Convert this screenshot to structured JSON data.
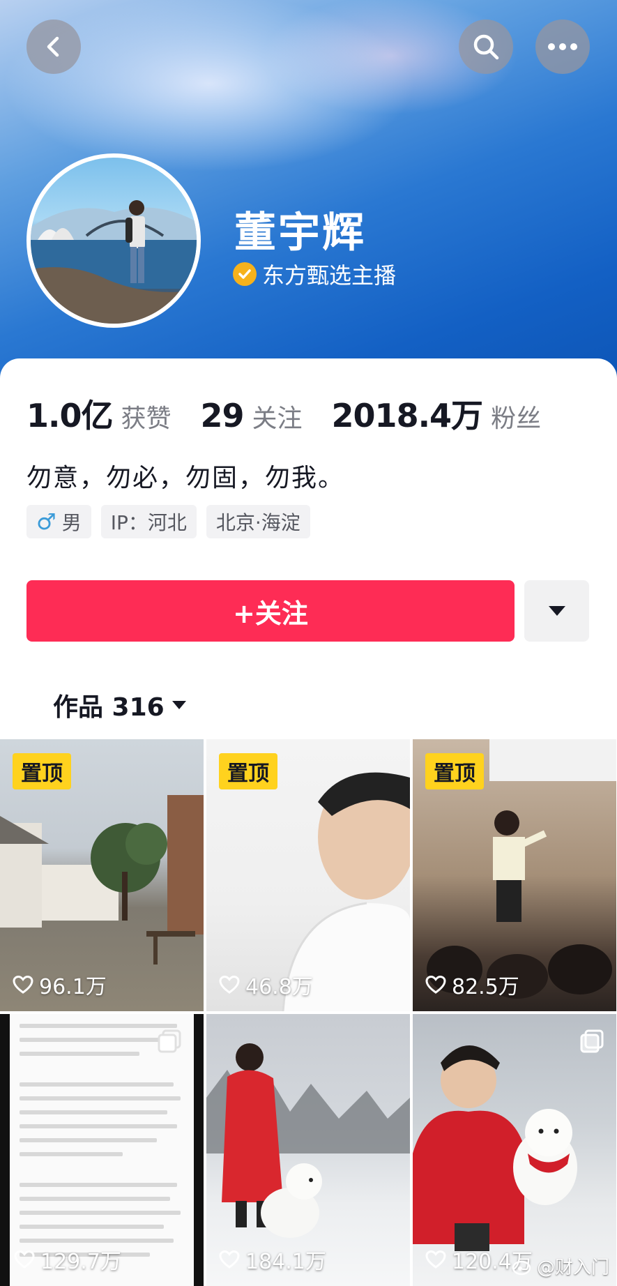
{
  "header": {
    "back_icon": "chevron-left-icon",
    "search_icon": "search-icon",
    "more_icon": "ellipsis-icon"
  },
  "profile": {
    "name": "董宇辉",
    "verified_label": "东方甄选主播",
    "verified_color": "#f6b21c"
  },
  "stats": {
    "likes_count": "1.0亿",
    "likes_label": "获赞",
    "following_count": "29",
    "following_label": "关注",
    "followers_count": "2018.4万",
    "followers_label": "粉丝"
  },
  "bio": "勿意，勿必，勿固，勿我。",
  "tags": {
    "gender_symbol": "♂",
    "gender": "男",
    "ip": "IP：河北",
    "location": "北京·海淀"
  },
  "actions": {
    "follow_label": "+关注",
    "follow_color": "#fe2c55"
  },
  "works": {
    "tab_label": "作品 316"
  },
  "videos": [
    {
      "pinned_label": "置顶",
      "likes": "96.1万"
    },
    {
      "pinned_label": "置顶",
      "likes": "46.8万"
    },
    {
      "pinned_label": "置顶",
      "likes": "82.5万"
    },
    {
      "likes": "129.7万"
    },
    {
      "likes": "184.1万"
    },
    {
      "likes": "120.4万"
    }
  ],
  "watermark": "@财入门"
}
